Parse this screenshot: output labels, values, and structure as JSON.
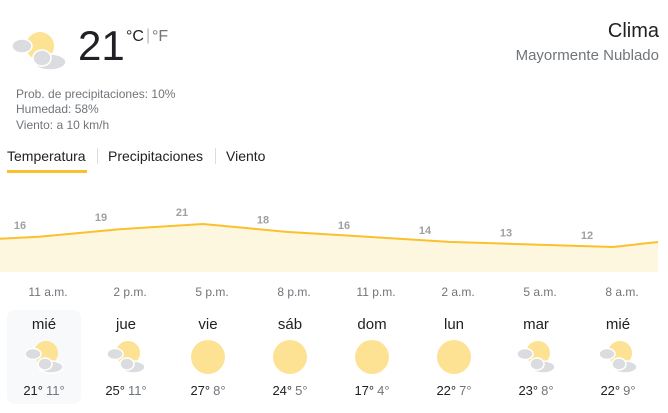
{
  "current": {
    "temp": "21",
    "unit_c": "°C",
    "unit_sep": "|",
    "unit_f": "°F",
    "icon": "partly-cloudy-icon",
    "precip": "Prob. de precipitaciones: 10%",
    "humidity": "Humedad: 58%",
    "wind": "Viento: a 10 km/h"
  },
  "header": {
    "title": "Clima",
    "condition": "Mayormente Nublado"
  },
  "tabs": [
    {
      "label": "Temperatura",
      "selected": true
    },
    {
      "label": "Precipitaciones",
      "selected": false
    },
    {
      "label": "Viento",
      "selected": false
    }
  ],
  "chart_data": {
    "type": "area",
    "color": "#fbc02d",
    "fill": "#fef7e0",
    "x": [
      "11 a.m.",
      "2 p.m.",
      "5 p.m.",
      "8 p.m.",
      "11 p.m.",
      "2 a.m.",
      "5 a.m.",
      "8 a.m."
    ],
    "values": [
      16,
      19,
      21,
      18,
      16,
      14,
      13,
      12
    ],
    "value_labels": [
      "16",
      "19",
      "21",
      "18",
      "16",
      "14",
      "13",
      "12"
    ]
  },
  "forecast": [
    {
      "day": "mié",
      "icon": "partly-cloudy-icon",
      "hi": "21°",
      "lo": "11°",
      "selected": true
    },
    {
      "day": "jue",
      "icon": "partly-cloudy-icon",
      "hi": "25°",
      "lo": "11°"
    },
    {
      "day": "vie",
      "icon": "sunny-icon",
      "hi": "27°",
      "lo": "8°"
    },
    {
      "day": "sáb",
      "icon": "sunny-icon",
      "hi": "24°",
      "lo": "5°"
    },
    {
      "day": "dom",
      "icon": "sunny-icon",
      "hi": "17°",
      "lo": "4°"
    },
    {
      "day": "lun",
      "icon": "sunny-icon",
      "hi": "22°",
      "lo": "7°"
    },
    {
      "day": "mar",
      "icon": "partly-cloudy-icon",
      "hi": "23°",
      "lo": "8°"
    },
    {
      "day": "mié",
      "icon": "partly-cloudy-icon",
      "hi": "22°",
      "lo": "9°"
    }
  ],
  "colors": {
    "sun": "#fde293",
    "cloud": "#dadce0",
    "accent": "#fbc02d"
  }
}
